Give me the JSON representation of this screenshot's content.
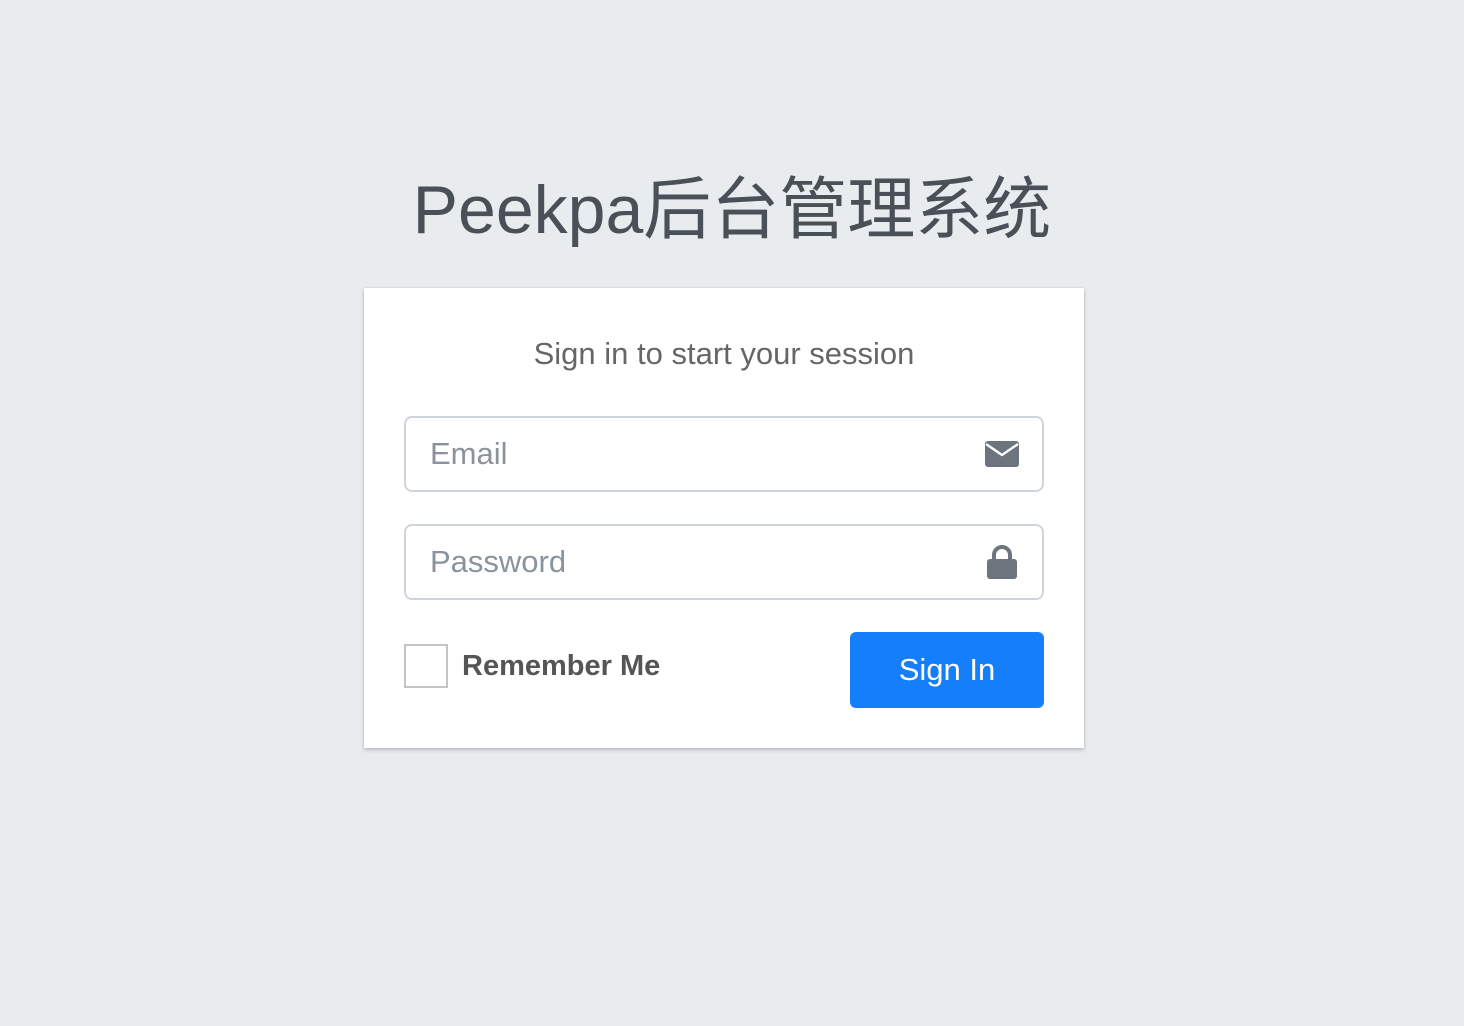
{
  "logo": {
    "text": "Peekpa后台管理系统"
  },
  "login": {
    "message": "Sign in to start your session",
    "email": {
      "placeholder": "Email",
      "value": "",
      "icon": "envelope-icon"
    },
    "password": {
      "placeholder": "Password",
      "value": "",
      "icon": "lock-icon"
    },
    "remember_label": "Remember Me",
    "remember_checked": false,
    "submit_label": "Sign In"
  },
  "colors": {
    "background": "#e9ecef",
    "card": "#ffffff",
    "primary": "#157ffb",
    "icon": "#6c757d"
  }
}
